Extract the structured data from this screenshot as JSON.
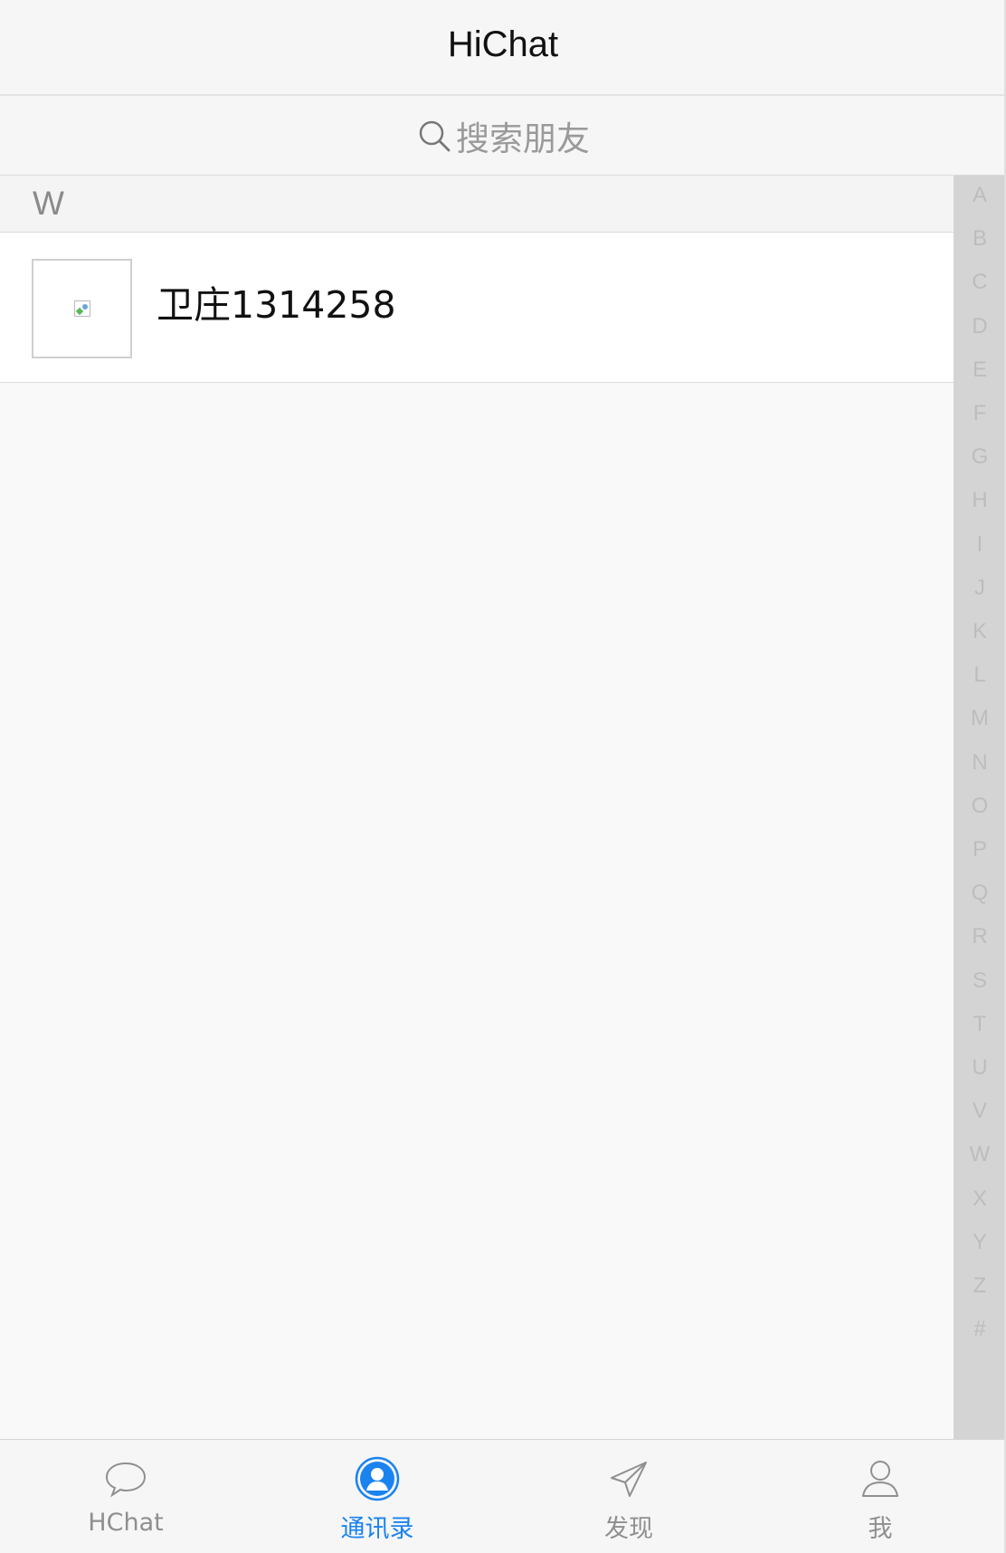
{
  "header": {
    "title": "HiChat"
  },
  "search": {
    "placeholder": "搜索朋友",
    "icon": "search-icon"
  },
  "contacts": {
    "sections": [
      {
        "letter": "W",
        "items": [
          {
            "name": "卫庄1314258",
            "avatar": "broken-image-icon"
          }
        ]
      }
    ]
  },
  "alpha_index": [
    "A",
    "B",
    "C",
    "D",
    "E",
    "F",
    "G",
    "H",
    "I",
    "J",
    "K",
    "L",
    "M",
    "N",
    "O",
    "P",
    "Q",
    "R",
    "S",
    "T",
    "U",
    "V",
    "W",
    "X",
    "Y",
    "Z",
    "#"
  ],
  "tabbar": {
    "tabs": [
      {
        "label": "HChat",
        "icon": "chat-bubble-icon",
        "active": false
      },
      {
        "label": "通讯录",
        "icon": "contacts-icon",
        "active": true
      },
      {
        "label": "发现",
        "icon": "paper-plane-icon",
        "active": false
      },
      {
        "label": "我",
        "icon": "user-icon",
        "active": false
      }
    ]
  },
  "colors": {
    "accent": "#1a83f0",
    "inactive": "#8f8f8f",
    "index_bg": "#d4d4d4"
  }
}
